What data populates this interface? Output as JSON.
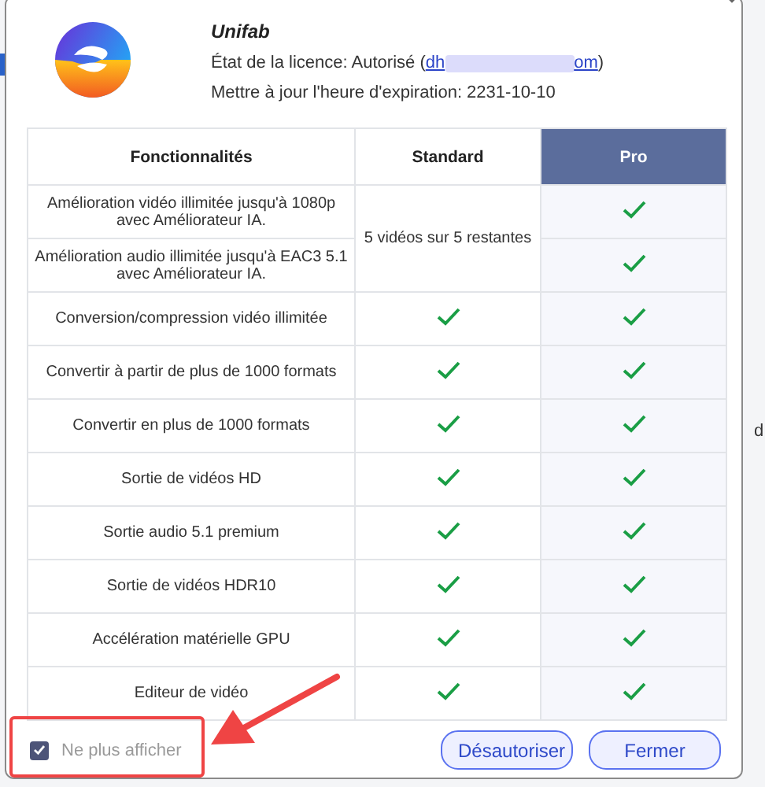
{
  "header": {
    "app_name": "Unifab",
    "license_label": "État de la licence: Autorisé (",
    "email_start": "dh",
    "email_end": "om",
    "license_close": ")",
    "expiry": "Mettre à jour l'heure d'expiration: 2231-10-10"
  },
  "table": {
    "columns": [
      {
        "label": "Fonctionnalités",
        "highlighted": false
      },
      {
        "label": "Standard",
        "highlighted": false
      },
      {
        "label": "Pro",
        "highlighted": true
      }
    ],
    "rows": [
      {
        "feature": "Amélioration vidéo illimitée jusqu'à 1080p avec Améliorateur IA.",
        "standard": {
          "kind": "text2",
          "text": "5 vidéos sur 5 restantes"
        },
        "pro": {
          "kind": "check"
        }
      },
      {
        "feature": "Amélioration audio illimitée jusqu'à EAC3 5.1 avec Améliorateur IA.",
        "standard": {
          "kind": "covered"
        },
        "pro": {
          "kind": "check"
        }
      },
      {
        "feature": "Conversion/compression vidéo illimitée",
        "standard": {
          "kind": "check"
        },
        "pro": {
          "kind": "check"
        }
      },
      {
        "feature": "Convertir à partir de plus de 1000 formats",
        "standard": {
          "kind": "check"
        },
        "pro": {
          "kind": "check"
        }
      },
      {
        "feature": "Convertir en plus de 1000 formats",
        "standard": {
          "kind": "check"
        },
        "pro": {
          "kind": "check"
        }
      },
      {
        "feature": "Sortie de vidéos HD",
        "standard": {
          "kind": "check"
        },
        "pro": {
          "kind": "check"
        }
      },
      {
        "feature": "Sortie audio 5.1 premium",
        "standard": {
          "kind": "check"
        },
        "pro": {
          "kind": "check"
        }
      },
      {
        "feature": "Sortie de vidéos HDR10",
        "standard": {
          "kind": "check"
        },
        "pro": {
          "kind": "check"
        }
      },
      {
        "feature": "Accélération matérielle GPU",
        "standard": {
          "kind": "check"
        },
        "pro": {
          "kind": "check"
        }
      },
      {
        "feature": "Editeur de vidéo",
        "standard": {
          "kind": "check"
        },
        "pro": {
          "kind": "check"
        }
      }
    ]
  },
  "footer": {
    "dont_show": {
      "label": "Ne plus afficher",
      "checked": true
    },
    "buttons": [
      "Désautoriser",
      "Fermer"
    ]
  },
  "background_fragment": "d"
}
